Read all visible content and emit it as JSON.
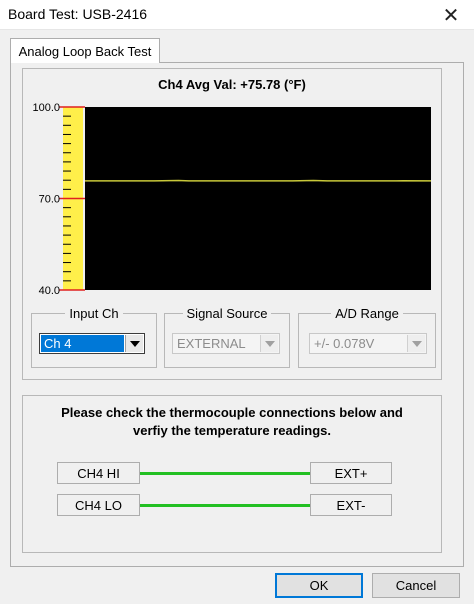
{
  "window": {
    "title": "Board Test: USB-2416",
    "close_glyph": "✕"
  },
  "tab": {
    "label": "Analog Loop Back Test"
  },
  "chart_data": {
    "type": "line",
    "title": "Ch4 Avg Val:  +75.78 (°F)",
    "ylim": [
      40.0,
      100.0
    ],
    "y_labels": [
      "100.0",
      "70.0",
      "40.0"
    ],
    "y_label_values": [
      100.0,
      70.0,
      40.0
    ],
    "minor_tick_step": 3,
    "xlim": [
      0,
      100
    ],
    "grid": false,
    "colors": {
      "plot_background": "#000000",
      "line": "#c8c83a",
      "scale_background": "#ffef4a",
      "scale_marks": "#e02020"
    },
    "series": [
      {
        "x": [
          0,
          10,
          20,
          27,
          30,
          40,
          50,
          60,
          66,
          70,
          80,
          90,
          92,
          100
        ],
        "values": [
          75.78,
          75.78,
          75.78,
          75.9,
          75.78,
          75.78,
          75.78,
          75.78,
          75.9,
          75.78,
          75.78,
          75.78,
          75.85,
          75.78
        ]
      }
    ]
  },
  "controls": {
    "input_ch": {
      "label": "Input Ch",
      "value": "Ch 4"
    },
    "signal_source": {
      "label": "Signal Source",
      "value": "EXTERNAL"
    },
    "ad_range": {
      "label": "A/D Range",
      "value": "+/- 0.078V"
    }
  },
  "connections": {
    "instruction_line1": "Please check the thermocouple connections below and",
    "instruction_line2": "verfiy the temperature readings.",
    "rows": [
      {
        "left": "CH4 HI",
        "right": "EXT+"
      },
      {
        "left": "CH4 LO",
        "right": "EXT-"
      }
    ],
    "wire_color": "#22c022"
  },
  "buttons": {
    "ok": "OK",
    "cancel": "Cancel"
  }
}
